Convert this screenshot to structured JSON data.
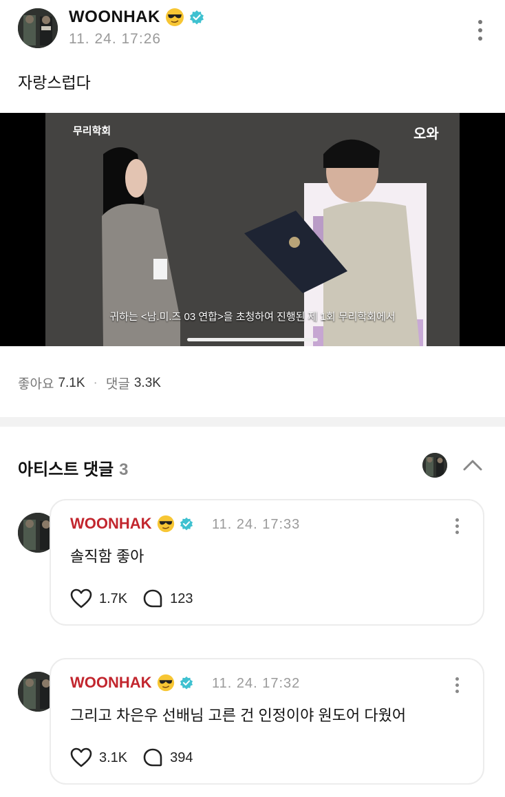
{
  "post": {
    "author": "WOONHAK",
    "author_emoji": "sunglasses-emoji",
    "verified_icon": "verified-badge-icon",
    "date": "11. 24. 17:26",
    "text": "자랑스럽다"
  },
  "video": {
    "logo_left": "무리학회",
    "logo_right": "오와",
    "caption": "귀하는 <남.미.즈 03 연합>을 초청하여 진행된 제 1회 무리학회에서"
  },
  "stats": {
    "likes_label": "좋아요",
    "likes_value": "7.1K",
    "comments_label": "댓글",
    "comments_value": "3.3K"
  },
  "artist_comments": {
    "title": "아티스트 댓글",
    "count": "3",
    "items": [
      {
        "author": "WOONHAK",
        "date": "11. 24. 17:33",
        "text": "솔직함 좋아",
        "likes": "1.7K",
        "replies": "123"
      },
      {
        "author": "WOONHAK",
        "date": "11. 24. 17:32",
        "text": "그리고 차은우 선배님 고른 건 인정이야 원도어 다웠어",
        "likes": "3.1K",
        "replies": "394"
      }
    ]
  },
  "colors": {
    "accent_name": "#c2262e",
    "verified": "#3fc1d0",
    "muted": "#9a9a9a"
  }
}
